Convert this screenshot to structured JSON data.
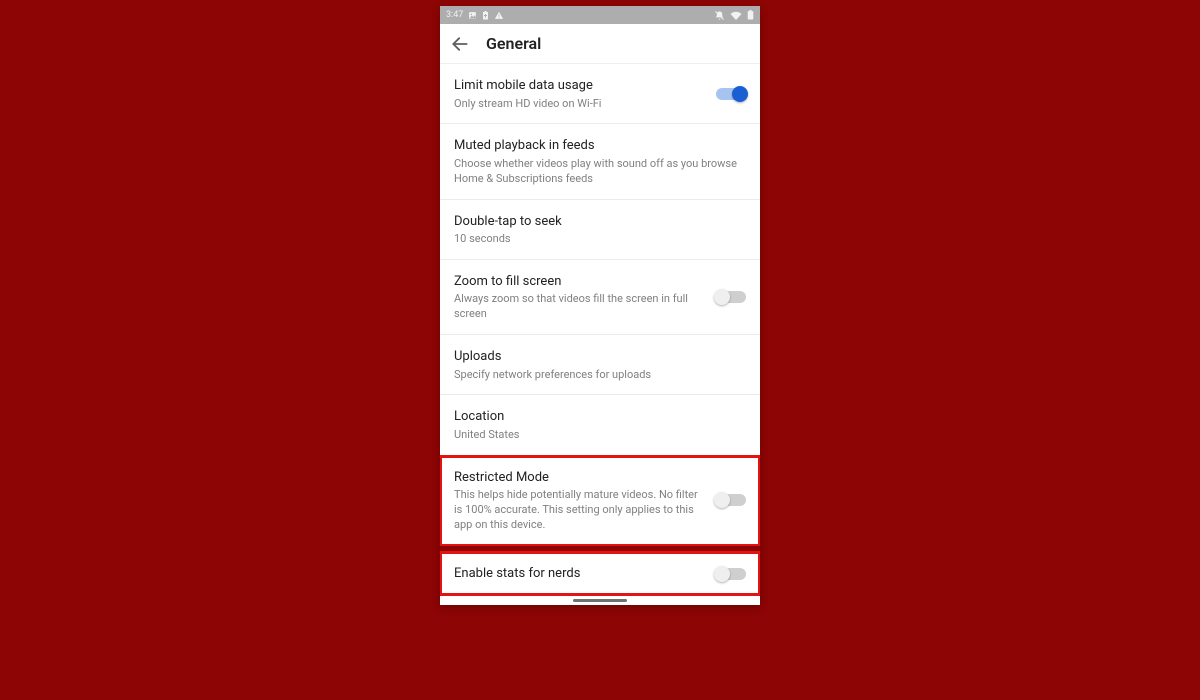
{
  "statusbar": {
    "time": "3:47"
  },
  "appbar": {
    "title": "General"
  },
  "settings": {
    "limit_data": {
      "title": "Limit mobile data usage",
      "sub": "Only stream HD video on Wi-Fi",
      "on": true
    },
    "muted_playback": {
      "title": "Muted playback in feeds",
      "sub": "Choose whether videos play with sound off as you browse Home & Subscriptions feeds"
    },
    "double_tap": {
      "title": "Double-tap to seek",
      "sub": "10 seconds"
    },
    "zoom": {
      "title": "Zoom to fill screen",
      "sub": "Always zoom so that videos fill the screen in full screen",
      "on": false
    },
    "uploads": {
      "title": "Uploads",
      "sub": "Specify network preferences for uploads"
    },
    "location": {
      "title": "Location",
      "sub": "United States"
    },
    "restricted": {
      "title": "Restricted Mode",
      "sub": "This helps hide potentially mature videos. No filter is 100% accurate. This setting only applies to this app on this device.",
      "on": false
    },
    "stats_nerds": {
      "title": "Enable stats for nerds",
      "on": false
    }
  }
}
